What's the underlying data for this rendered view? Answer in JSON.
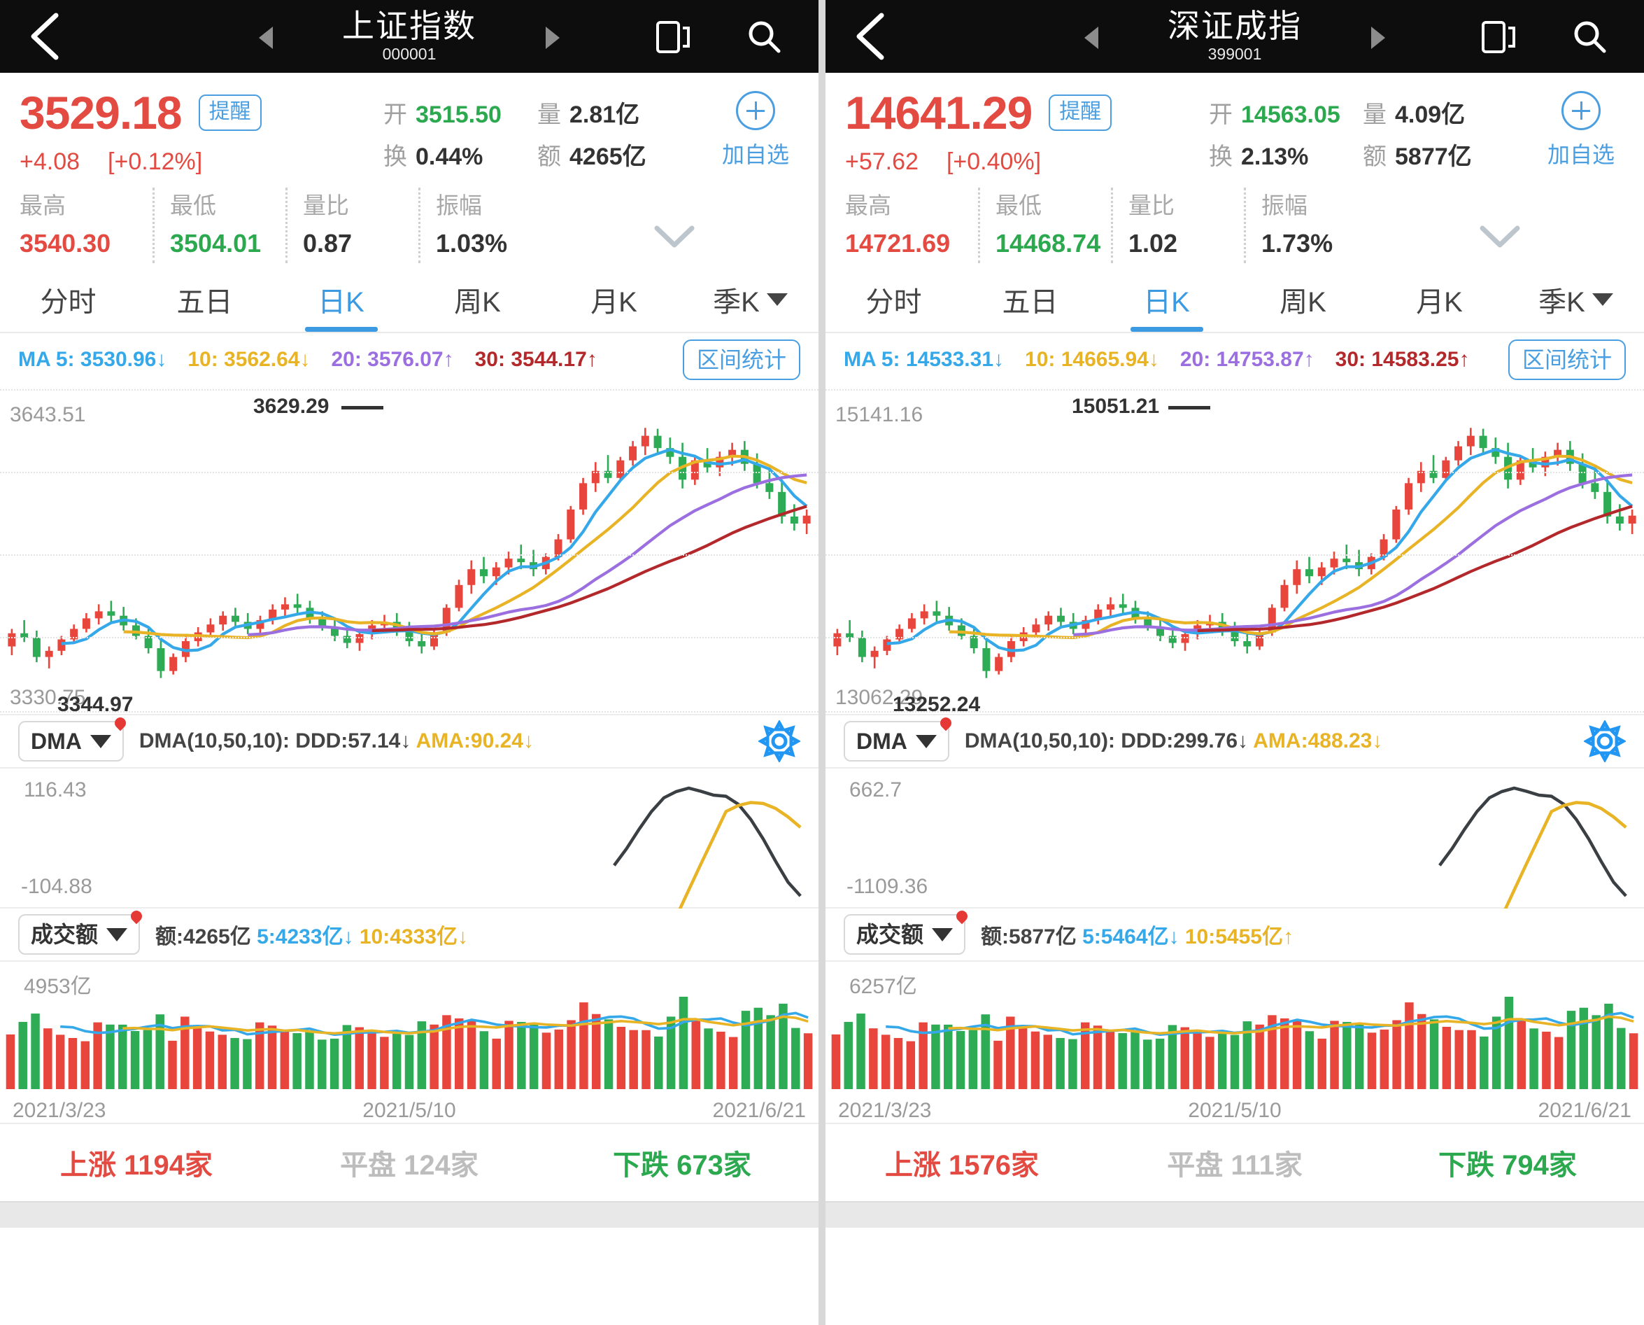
{
  "panels": [
    {
      "nav": {
        "title": "上证指数",
        "code": "000001",
        "back_icon": "chevron-left-icon",
        "prev_icon": "triangle-left-icon",
        "next_icon": "triangle-right-icon",
        "phone_icon": "device-icon",
        "search_icon": "search-icon"
      },
      "quote": {
        "price": "3529.18",
        "alert_label": "提醒",
        "change": "+4.08",
        "change_pct": "[+0.12%]",
        "open_label": "开",
        "open_value": "3515.50",
        "vol_label": "量",
        "vol_value": "2.81亿",
        "turnover_label": "换",
        "turnover_value": "0.44%",
        "amount_label": "额",
        "amount_value": "4265亿",
        "add_label": "加自选",
        "stats": [
          {
            "label": "最高",
            "value": "3540.30",
            "color": "red"
          },
          {
            "label": "最低",
            "value": "3504.01",
            "color": "green"
          },
          {
            "label": "量比",
            "value": "0.87",
            "color": "dark"
          },
          {
            "label": "振幅",
            "value": "1.03%",
            "color": "dark"
          }
        ]
      },
      "tabs": [
        {
          "label": "分时",
          "active": false
        },
        {
          "label": "五日",
          "active": false
        },
        {
          "label": "日K",
          "active": true
        },
        {
          "label": "周K",
          "active": false
        },
        {
          "label": "月K",
          "active": false
        },
        {
          "label": "季K",
          "active": false,
          "caret": true
        }
      ],
      "ma": {
        "ma5": "MA 5: 3530.96↓",
        "ma10": "10: 3562.64↓",
        "ma20": "20: 3576.07↑",
        "ma30": "30: 3544.17↑",
        "range_button": "区间统计"
      },
      "kchart": {
        "top_label": "3643.51",
        "bottom_label": "3330.75",
        "bottom_label2": "3344.97",
        "high_tag": "3629.29"
      },
      "dma": {
        "selector": "DMA",
        "text_prefix": "DMA(10,50,10):  DDD:57.14↓",
        "ama": "AMA:90.24↓",
        "top_label": "116.43",
        "bottom_label": "-104.88",
        "gear_icon": "gear-icon"
      },
      "vol": {
        "selector": "成交额",
        "text_prefix": "额:4265亿",
        "ma5": "5:4233亿↓",
        "ma10": "10:4333亿↓",
        "top_label": "4953亿"
      },
      "dates": [
        "2021/3/23",
        "2021/5/10",
        "2021/6/21"
      ],
      "breadth": {
        "up": "上涨 1194家",
        "flat": "平盘 124家",
        "down": "下跌 673家"
      }
    },
    {
      "nav": {
        "title": "深证成指",
        "code": "399001",
        "back_icon": "chevron-left-icon",
        "prev_icon": "triangle-left-icon",
        "next_icon": "triangle-right-icon",
        "phone_icon": "device-icon",
        "search_icon": "search-icon"
      },
      "quote": {
        "price": "14641.29",
        "alert_label": "提醒",
        "change": "+57.62",
        "change_pct": "[+0.40%]",
        "open_label": "开",
        "open_value": "14563.05",
        "vol_label": "量",
        "vol_value": "4.09亿",
        "turnover_label": "换",
        "turnover_value": "2.13%",
        "amount_label": "额",
        "amount_value": "5877亿",
        "add_label": "加自选",
        "stats": [
          {
            "label": "最高",
            "value": "14721.69",
            "color": "red"
          },
          {
            "label": "最低",
            "value": "14468.74",
            "color": "green"
          },
          {
            "label": "量比",
            "value": "1.02",
            "color": "dark"
          },
          {
            "label": "振幅",
            "value": "1.73%",
            "color": "dark"
          }
        ]
      },
      "tabs": [
        {
          "label": "分时",
          "active": false
        },
        {
          "label": "五日",
          "active": false
        },
        {
          "label": "日K",
          "active": true
        },
        {
          "label": "周K",
          "active": false
        },
        {
          "label": "月K",
          "active": false
        },
        {
          "label": "季K",
          "active": false,
          "caret": true
        }
      ],
      "ma": {
        "ma5": "MA 5: 14533.31↓",
        "ma10": "10: 14665.94↓",
        "ma20": "20: 14753.87↑",
        "ma30": "30: 14583.25↑",
        "range_button": "区间统计"
      },
      "kchart": {
        "top_label": "15141.16",
        "bottom_label": "13062.29",
        "bottom_label2": "13252.24",
        "high_tag": "15051.21"
      },
      "dma": {
        "selector": "DMA",
        "text_prefix": "DMA(10,50,10):  DDD:299.76↓",
        "ama": "AMA:488.23↓",
        "top_label": "662.7",
        "bottom_label": "-1109.36",
        "gear_icon": "gear-icon"
      },
      "vol": {
        "selector": "成交额",
        "text_prefix": "额:5877亿",
        "ma5": "5:5464亿↓",
        "ma10": "10:5455亿↑",
        "top_label": "6257亿"
      },
      "dates": [
        "2021/3/23",
        "2021/5/10",
        "2021/6/21"
      ],
      "breadth": {
        "up": "上涨 1576家",
        "flat": "平盘 111家",
        "down": "下跌 794家"
      }
    }
  ],
  "chart_data": {
    "type": "candlestick",
    "panels": [
      {
        "name": "上证指数 000001 日K",
        "ylim": [
          3330.75,
          3643.51
        ],
        "x_ticks": [
          "2021/3/23",
          "2021/5/10",
          "2021/6/21"
        ],
        "annotation_high": 3629.29,
        "annotation_low": 3344.97,
        "ma_series": [
          {
            "name": "MA5",
            "last": 3530.96,
            "color": "#34a8e8"
          },
          {
            "name": "MA10",
            "last": 3562.64,
            "color": "#e8b324"
          },
          {
            "name": "MA20",
            "last": 3576.07,
            "color": "#9b6fe0"
          },
          {
            "name": "MA30",
            "last": 3544.17,
            "color": "#b3282b"
          }
        ],
        "ohlc": [
          [
            3380,
            3400,
            3370,
            3395
          ],
          [
            3395,
            3410,
            3385,
            3390
          ],
          [
            3390,
            3398,
            3362,
            3368
          ],
          [
            3368,
            3380,
            3355,
            3375
          ],
          [
            3375,
            3392,
            3370,
            3388
          ],
          [
            3388,
            3405,
            3383,
            3400
          ],
          [
            3400,
            3418,
            3396,
            3412
          ],
          [
            3412,
            3428,
            3405,
            3420
          ],
          [
            3420,
            3432,
            3408,
            3415
          ],
          [
            3415,
            3425,
            3398,
            3404
          ],
          [
            3404,
            3412,
            3388,
            3392
          ],
          [
            3392,
            3400,
            3372,
            3378
          ],
          [
            3378,
            3390,
            3344,
            3352
          ],
          [
            3352,
            3372,
            3348,
            3368
          ],
          [
            3368,
            3392,
            3362,
            3386
          ],
          [
            3386,
            3402,
            3380,
            3396
          ],
          [
            3396,
            3412,
            3390,
            3405
          ],
          [
            3405,
            3420,
            3398,
            3415
          ],
          [
            3415,
            3424,
            3402,
            3408
          ],
          [
            3408,
            3418,
            3394,
            3400
          ],
          [
            3400,
            3415,
            3392,
            3410
          ],
          [
            3410,
            3428,
            3405,
            3422
          ],
          [
            3422,
            3436,
            3414,
            3428
          ],
          [
            3428,
            3440,
            3418,
            3424
          ],
          [
            3424,
            3432,
            3406,
            3412
          ],
          [
            3412,
            3420,
            3398,
            3402
          ],
          [
            3402,
            3412,
            3386,
            3392
          ],
          [
            3392,
            3400,
            3378,
            3384
          ],
          [
            3384,
            3398,
            3375,
            3394
          ],
          [
            3394,
            3410,
            3388,
            3404
          ],
          [
            3404,
            3416,
            3396,
            3408
          ],
          [
            3408,
            3418,
            3392,
            3398
          ],
          [
            3398,
            3408,
            3380,
            3386
          ],
          [
            3386,
            3396,
            3372,
            3380
          ],
          [
            3380,
            3400,
            3376,
            3396
          ],
          [
            3396,
            3428,
            3392,
            3424
          ],
          [
            3424,
            3456,
            3420,
            3450
          ],
          [
            3450,
            3478,
            3440,
            3468
          ],
          [
            3468,
            3482,
            3452,
            3460
          ],
          [
            3460,
            3476,
            3450,
            3470
          ],
          [
            3470,
            3488,
            3462,
            3480
          ],
          [
            3480,
            3496,
            3468,
            3476
          ],
          [
            3476,
            3490,
            3460,
            3468
          ],
          [
            3468,
            3486,
            3462,
            3482
          ],
          [
            3482,
            3508,
            3478,
            3502
          ],
          [
            3502,
            3540,
            3498,
            3536
          ],
          [
            3536,
            3572,
            3530,
            3566
          ],
          [
            3566,
            3590,
            3556,
            3580
          ],
          [
            3580,
            3598,
            3566,
            3572
          ],
          [
            3572,
            3596,
            3568,
            3592
          ],
          [
            3592,
            3614,
            3586,
            3608
          ],
          [
            3608,
            3629,
            3598,
            3620
          ],
          [
            3620,
            3628,
            3600,
            3606
          ],
          [
            3606,
            3618,
            3588,
            3596
          ],
          [
            3596,
            3612,
            3560,
            3570
          ],
          [
            3570,
            3598,
            3564,
            3592
          ],
          [
            3592,
            3606,
            3578,
            3584
          ],
          [
            3584,
            3602,
            3574,
            3596
          ],
          [
            3596,
            3612,
            3586,
            3604
          ],
          [
            3604,
            3614,
            3580,
            3588
          ],
          [
            3588,
            3600,
            3560,
            3566
          ],
          [
            3566,
            3584,
            3548,
            3556
          ],
          [
            3556,
            3570,
            3520,
            3528
          ],
          [
            3528,
            3542,
            3512,
            3520
          ],
          [
            3520,
            3536,
            3508,
            3529
          ]
        ],
        "volume_top_label": "4953亿"
      },
      {
        "name": "深证成指 399001 日K",
        "ylim": [
          13062.29,
          15141.16
        ],
        "x_ticks": [
          "2021/3/23",
          "2021/5/10",
          "2021/6/21"
        ],
        "annotation_high": 15051.21,
        "annotation_low": 13252.24,
        "ma_series": [
          {
            "name": "MA5",
            "last": 14533.31,
            "color": "#34a8e8"
          },
          {
            "name": "MA10",
            "last": 14665.94,
            "color": "#e8b324"
          },
          {
            "name": "MA20",
            "last": 14753.87,
            "color": "#9b6fe0"
          },
          {
            "name": "MA30",
            "last": 14583.25,
            "color": "#b3282b"
          }
        ],
        "volume_top_label": "6257亿"
      }
    ]
  }
}
